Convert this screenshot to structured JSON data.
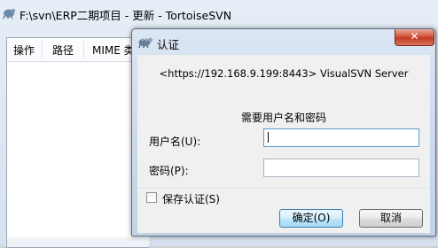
{
  "background_window": {
    "title": "F:\\svn\\ERP二期项目 - 更新 - TortoiseSVN",
    "columns": [
      "操作",
      "路径",
      "MIME 类型"
    ]
  },
  "dialog": {
    "title": "认证",
    "close_label": "✕",
    "realm": "<https://192.168.9.199:8443> VisualSVN Server",
    "prompt": "需要用户名和密码",
    "username_label": "用户名(U):",
    "username_value": "",
    "password_label": "密码(P):",
    "password_value": "",
    "save_auth_label": "保存认证(S)",
    "save_auth_checked": false,
    "ok_label": "确定(O)",
    "cancel_label": "取消"
  }
}
